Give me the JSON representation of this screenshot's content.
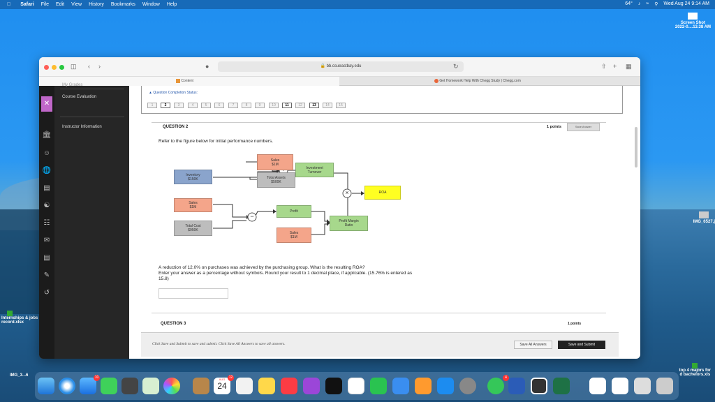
{
  "menubar": {
    "app": "Safari",
    "items": [
      "File",
      "Edit",
      "View",
      "History",
      "Bookmarks",
      "Window",
      "Help"
    ],
    "status": {
      "temp": "64°",
      "datetime": "Wed Aug 24  9:14 AM"
    }
  },
  "desktop": {
    "screenshot_label": "Screen Shot",
    "screenshot_sub": "2022-0....13.38 AM",
    "img_label": "IMG_6527.j",
    "file_left_1": "Internships & jobs",
    "file_left_1b": "record.xlsx",
    "file_right_1": "top 4 majors for",
    "file_right_1b": "d bachelors.xls",
    "img_left": "IMG_3...6"
  },
  "browser": {
    "url": "bb.csueastbay.edu",
    "tabs": [
      {
        "label": "Content"
      },
      {
        "label": "Get Homework Help With Chegg Study | Chegg.com"
      }
    ]
  },
  "sidebar": {
    "partial_item": "My Grades",
    "items": [
      "Course Evaluation",
      "Instructor Information"
    ]
  },
  "quiz": {
    "status_label": "Question Completion Status:",
    "questions": [
      "1",
      "2",
      "3",
      "4",
      "5",
      "6",
      "7",
      "8",
      "9",
      "10",
      "11",
      "12",
      "13",
      "14",
      "15"
    ],
    "question_title": "QUESTION 2",
    "points": "1 points",
    "save_answer": "Save Answer",
    "prompt": "Refer to the figure below for initial performance numbers.",
    "question_text_1": "A reduction of 12.0% on purchases was achieved by the purchasing group.  What is the resulting ROA?",
    "question_text_2": "Enter your answer as a percentage without symbols.  Round your result to 1 decimal place, if applicable.   (15.76% is entered as",
    "question_text_3": "15.8)",
    "next_title": "QUESTION 3",
    "next_points": "1 points",
    "footer_text": "Click Save and Submit to save and submit. Click Save All Answers to save all answers.",
    "save_all": "Save All Answers",
    "save_submit": "Save and Submit"
  },
  "diagram": {
    "sales_top": {
      "l1": "Sales",
      "l2": "$1M"
    },
    "inventory": {
      "l1": "Inventory",
      "l2": "$150K"
    },
    "total_assets": {
      "l1": "Total Assets",
      "l2": "$500K"
    },
    "investment_turnover": {
      "l1": "Investment",
      "l2": "Turnover"
    },
    "roa": "ROA",
    "sales_mid": {
      "l1": "Sales",
      "l2": "$1M"
    },
    "profit": "Profit",
    "total_cost": {
      "l1": "Total Cost",
      "l2": "$950K"
    },
    "sales_bottom": {
      "l1": "Sales",
      "l2": "$1M"
    },
    "profit_margin": {
      "l1": "Profit Margin",
      "l2": "Ratio"
    },
    "op_plus": "+",
    "op_times": "×",
    "op_minus": "−",
    "op_div": "÷"
  },
  "dock": {
    "mail_badge": "10",
    "calendar_month": "AUG",
    "calendar_day": "24",
    "messages_badge": "4",
    "cal_badge": "12"
  }
}
